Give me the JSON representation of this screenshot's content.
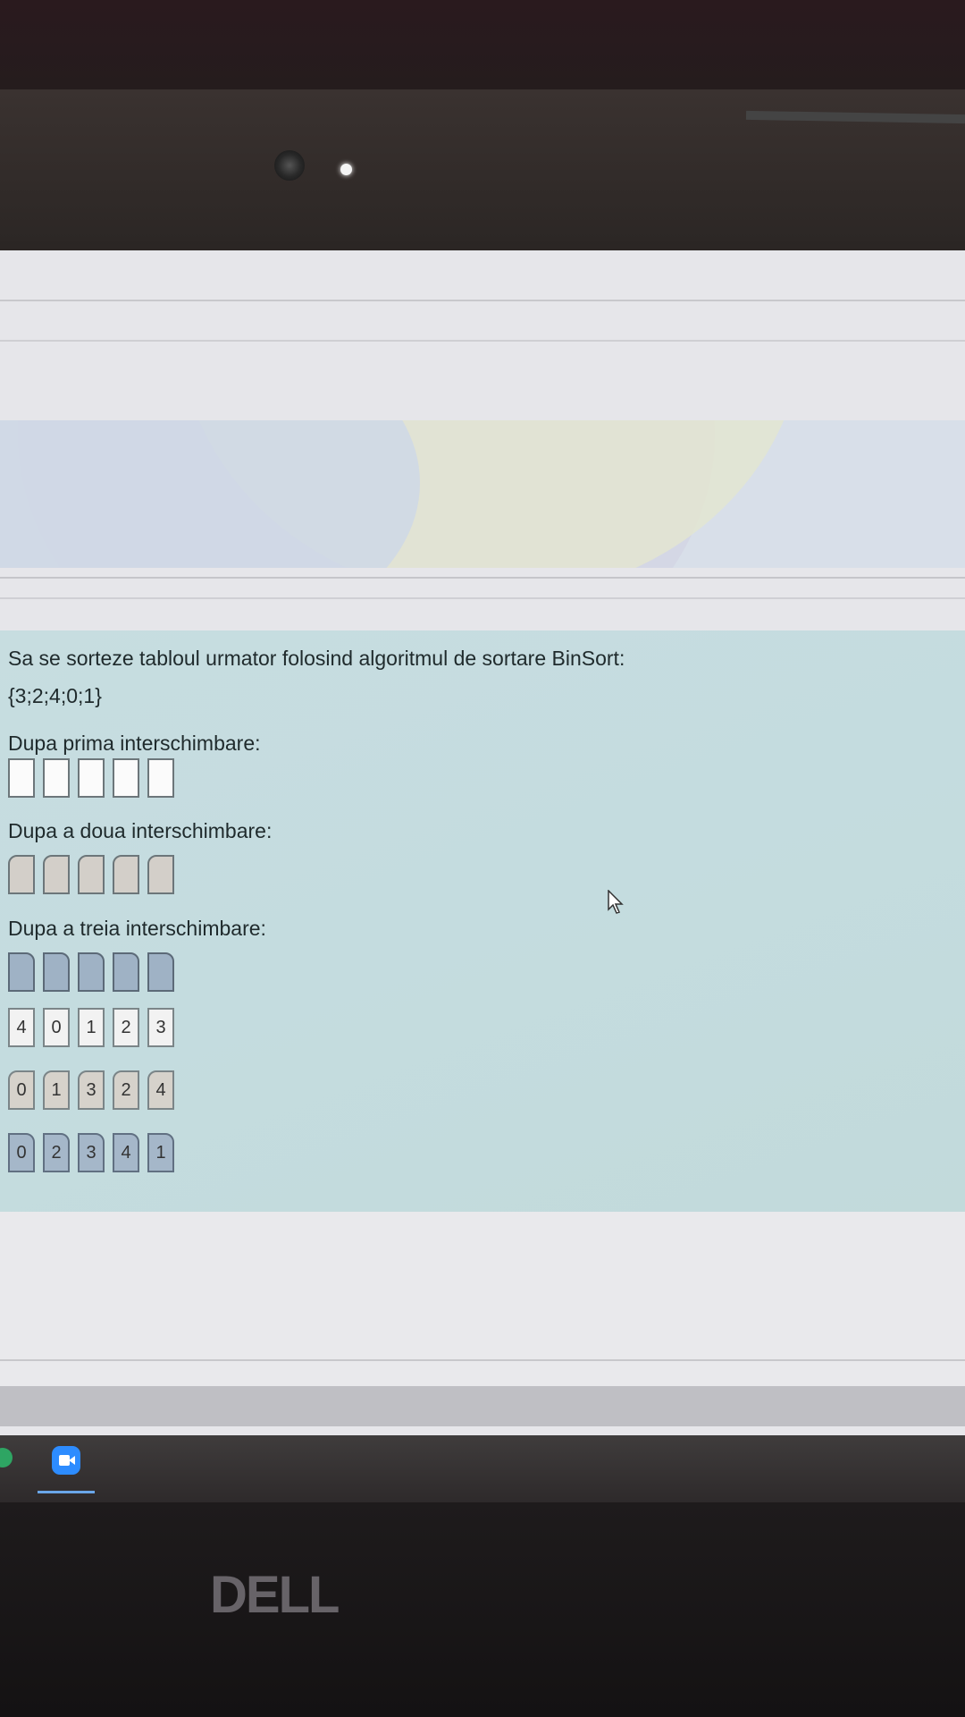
{
  "question": {
    "prompt": "Sa se sorteze tabloul urmator folosind algoritmul de sortare BinSort:",
    "array": "{3;2;4;0;1}",
    "step1_label": "Dupa prima interschimbare:",
    "step2_label": "Dupa a doua interschimbare:",
    "step3_label": "Dupa a treia interschimbare:",
    "drag_rows": [
      [
        "4",
        "0",
        "1",
        "2",
        "3"
      ],
      [
        "0",
        "1",
        "3",
        "2",
        "4"
      ],
      [
        "0",
        "2",
        "3",
        "4",
        "1"
      ]
    ]
  },
  "taskbar": {
    "apps": [
      "green-app-icon",
      "zoom-icon"
    ]
  },
  "device": {
    "logo": "DELL"
  },
  "colors": {
    "question_bg": "#c4dcdf",
    "drop_box_white": "#fbfbfb",
    "drop_box_tan": "#d3cfc9",
    "drop_box_blue": "#9fb2c5",
    "zoom_blue": "#2d8cff"
  }
}
